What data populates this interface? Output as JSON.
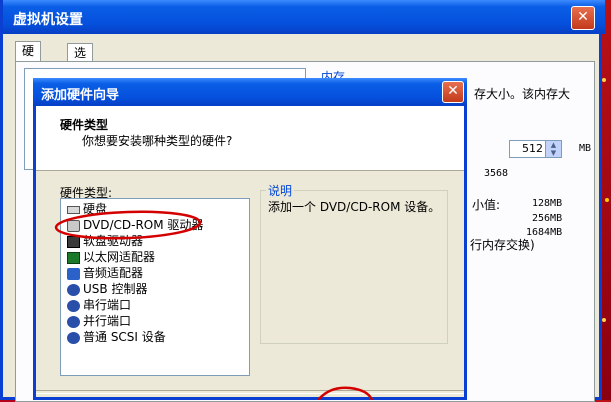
{
  "main_window": {
    "title": "虚拟机设置",
    "tabs": [
      {
        "label": "硬件"
      },
      {
        "label": "选项"
      }
    ],
    "memory": {
      "group_label": "内存",
      "description": "存大小。该内存大",
      "value": "512",
      "unit": "MB",
      "max_value": "3568",
      "min_label": "小值:",
      "sizes": [
        "128MB",
        "256MB",
        "1684MB"
      ],
      "swap_note": "行内存交换)"
    }
  },
  "wizard": {
    "title": "添加硬件向导",
    "heading": "硬件类型",
    "subheading": "你想要安装哪种类型的硬件?",
    "list_label": "硬件类型:",
    "hardware_types": [
      {
        "label": "硬盘",
        "icon": "hard-disk-icon"
      },
      {
        "label": "DVD/CD-ROM 驱动器",
        "icon": "cdrom-icon"
      },
      {
        "label": "软盘驱动器",
        "icon": "floppy-icon"
      },
      {
        "label": "以太网适配器",
        "icon": "network-adapter-icon"
      },
      {
        "label": "音频适配器",
        "icon": "speaker-icon"
      },
      {
        "label": "USB 控制器",
        "icon": "usb-icon"
      },
      {
        "label": "串行端口",
        "icon": "serial-port-icon"
      },
      {
        "label": "并行端口",
        "icon": "parallel-port-icon"
      },
      {
        "label": "普通 SCSI 设备",
        "icon": "scsi-icon"
      }
    ],
    "description_label": "说明",
    "description_text": "添加一个 DVD/CD-ROM 设备。"
  },
  "colors": {
    "titlebar": "#0550dd",
    "window_bg": "#ece9d8",
    "annotation": "#d40000",
    "link_blue": "#0046d5"
  }
}
